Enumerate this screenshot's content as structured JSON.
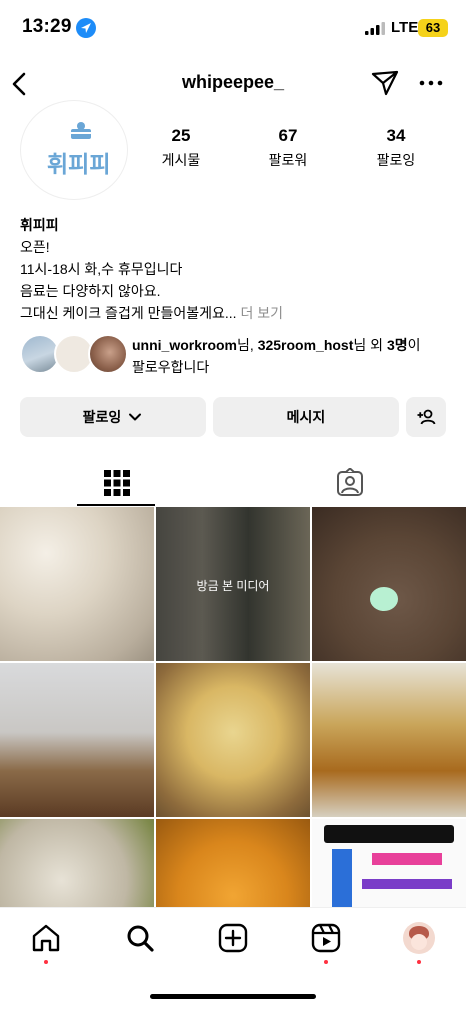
{
  "status": {
    "time": "13:29",
    "network": "LTE",
    "battery": "63"
  },
  "nav": {
    "username": "whipeepee_"
  },
  "profile": {
    "avatar_logo_text": "휘피피",
    "stats": [
      {
        "value": "25",
        "label": "게시물"
      },
      {
        "value": "67",
        "label": "팔로워"
      },
      {
        "value": "34",
        "label": "팔로잉"
      }
    ],
    "bio": {
      "name": "휘피피",
      "lines": [
        "오픈!",
        "11시-18시 화,수 휴무입니다",
        "음료는 다양하지 않아요."
      ],
      "truncated_line": "그대신 케이크 즐겁게 만들어볼게요...",
      "more_label": "더 보기"
    },
    "followed_by": {
      "user1": "unni_workroom",
      "sep1": "님, ",
      "user2": "325room_host",
      "sep2": "님 외 ",
      "count": "3명",
      "suffix": "이",
      "line2": "팔로우합니다"
    }
  },
  "buttons": {
    "following": "팔로잉",
    "message": "메시지"
  },
  "grid": {
    "recent_media_label": "방금 본 미디어"
  },
  "colors": {
    "accent_dot": "#ff3040",
    "battery": "#f5d21a",
    "button_bg": "#efefef"
  },
  "icons": [
    "back-icon",
    "send-icon",
    "more-icon",
    "grid-icon",
    "tagged-icon",
    "home-icon",
    "search-icon",
    "create-icon",
    "reels-icon",
    "add-person-icon",
    "chevron-down-icon"
  ]
}
